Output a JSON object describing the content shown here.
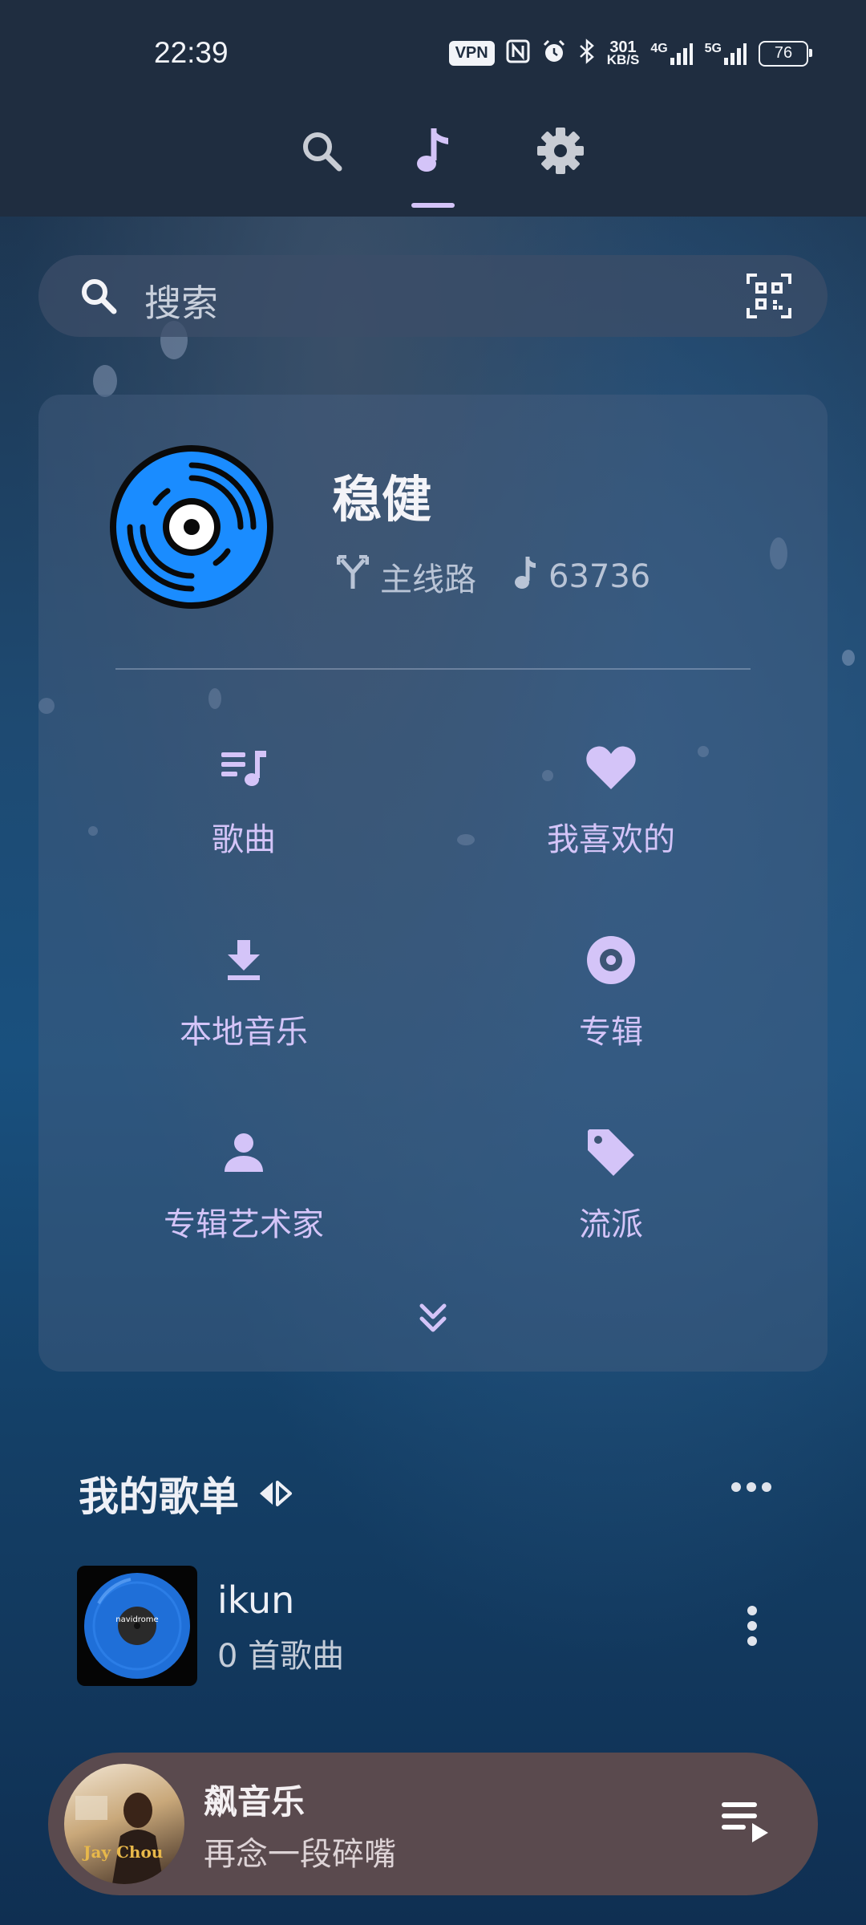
{
  "status_bar": {
    "time": "22:39",
    "vpn": "VPN",
    "speed_value": "301",
    "speed_unit": "KB/S",
    "net1": "4G",
    "net2": "5G",
    "battery": "76"
  },
  "top_nav": {
    "tabs": [
      {
        "name": "search",
        "icon": "search-icon",
        "active": false
      },
      {
        "name": "music",
        "icon": "music-note-icon",
        "active": true
      },
      {
        "name": "settings",
        "icon": "gear-icon",
        "active": false
      }
    ],
    "accent": "#d4c4f8"
  },
  "search": {
    "placeholder": "搜索"
  },
  "server_card": {
    "name": "稳健",
    "route_label": "主线路",
    "song_count": "63736",
    "grid": [
      {
        "icon": "playlist-music-icon",
        "label": "歌曲"
      },
      {
        "icon": "heart-icon",
        "label": "我喜欢的"
      },
      {
        "icon": "download-icon",
        "label": "本地音乐"
      },
      {
        "icon": "album-disc-icon",
        "label": "专辑"
      },
      {
        "icon": "person-icon",
        "label": "专辑艺术家"
      },
      {
        "icon": "tag-icon",
        "label": "流派"
      }
    ]
  },
  "playlists": {
    "header": "我的歌单",
    "items": [
      {
        "name": "ikun",
        "count_text": "0 首歌曲",
        "cover_text": "navidrome"
      }
    ]
  },
  "mini_player": {
    "title": "飙音乐",
    "subtitle": "再念一段碎嘴",
    "cover_text": "Jay Chou"
  }
}
